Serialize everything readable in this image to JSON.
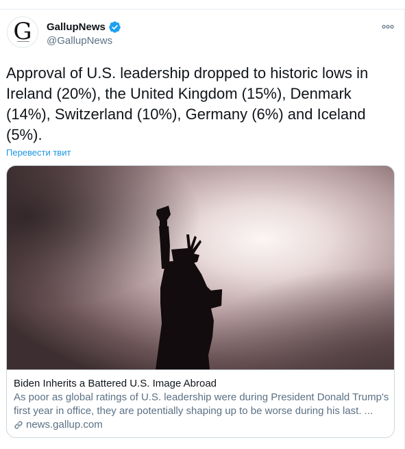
{
  "account": {
    "avatar_letter": "G",
    "display_name": "GallupNews",
    "handle": "@GallupNews"
  },
  "tweet": {
    "text": "Approval of U.S. leadership dropped to historic lows in Ireland (20%), the United Kingdom (15%), Denmark (14%), Switzerland (10%), Germany (6%) and Iceland (5%).",
    "translate_label": "Перевести твит"
  },
  "card": {
    "title": "Biden Inherits a Battered U.S. Image Abroad",
    "description": "As poor as global ratings of U.S. leadership were during President Donald Trump's first year in office, they are potentially shaping up to be worse during his last. ...",
    "domain": "news.gallup.com"
  },
  "colors": {
    "link_blue": "#1b95e0",
    "verified_blue": "#1da1f2",
    "secondary_text": "#5b7083"
  },
  "icons": [
    "verified-badge-icon",
    "more-options-icon",
    "link-icon"
  ]
}
